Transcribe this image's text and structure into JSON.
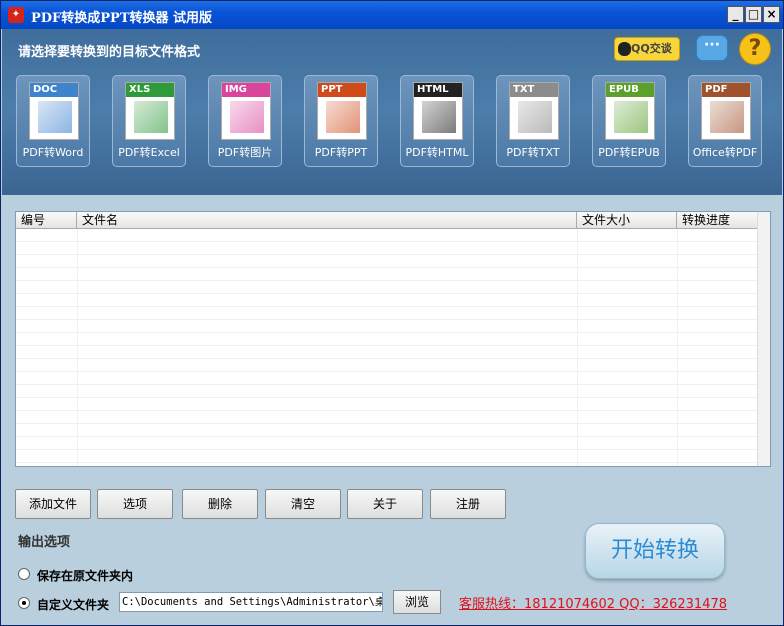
{
  "window": {
    "title": "PDF转换成PPT转换器  试用版",
    "app_icon": "pdf-app-icon"
  },
  "header": {
    "prompt": "请选择要转换到的目标文件格式",
    "qq_label": "QQ交谈",
    "chat_icon": "chat-bubble-icon",
    "help_icon": "question-icon"
  },
  "formats": [
    {
      "band": "DOC",
      "label": "PDF转Word",
      "color": "#3f83cf"
    },
    {
      "band": "XLS",
      "label": "PDF转Excel",
      "color": "#2f9a3a"
    },
    {
      "band": "IMG",
      "label": "PDF转图片",
      "color": "#d9449c"
    },
    {
      "band": "PPT",
      "label": "PDF转PPT",
      "color": "#cf4b1c"
    },
    {
      "band": "HTML",
      "label": "PDF转HTML",
      "color": "#222222"
    },
    {
      "band": "TXT",
      "label": "PDF转TXT",
      "color": "#8c8c8c"
    },
    {
      "band": "EPUB",
      "label": "PDF转EPUB",
      "color": "#5aa02c"
    },
    {
      "band": "PDF",
      "label": "Office转PDF",
      "color": "#a0522d"
    }
  ],
  "table": {
    "columns": [
      "编号",
      "文件名",
      "文件大小",
      "转换进度"
    ]
  },
  "buttons": {
    "add": "添加文件",
    "options": "选项",
    "delete": "删除",
    "clear": "清空",
    "about": "关于",
    "register": "注册"
  },
  "output": {
    "section_title": "输出选项",
    "radio_original": "保存在原文件夹内",
    "radio_custom": "自定义文件夹",
    "path": "C:\\Documents and Settings\\Administrator\\桌面",
    "browse": "浏览"
  },
  "start_label": "开始转换",
  "hotline": "客服热线：18121074602 QQ：326231478"
}
